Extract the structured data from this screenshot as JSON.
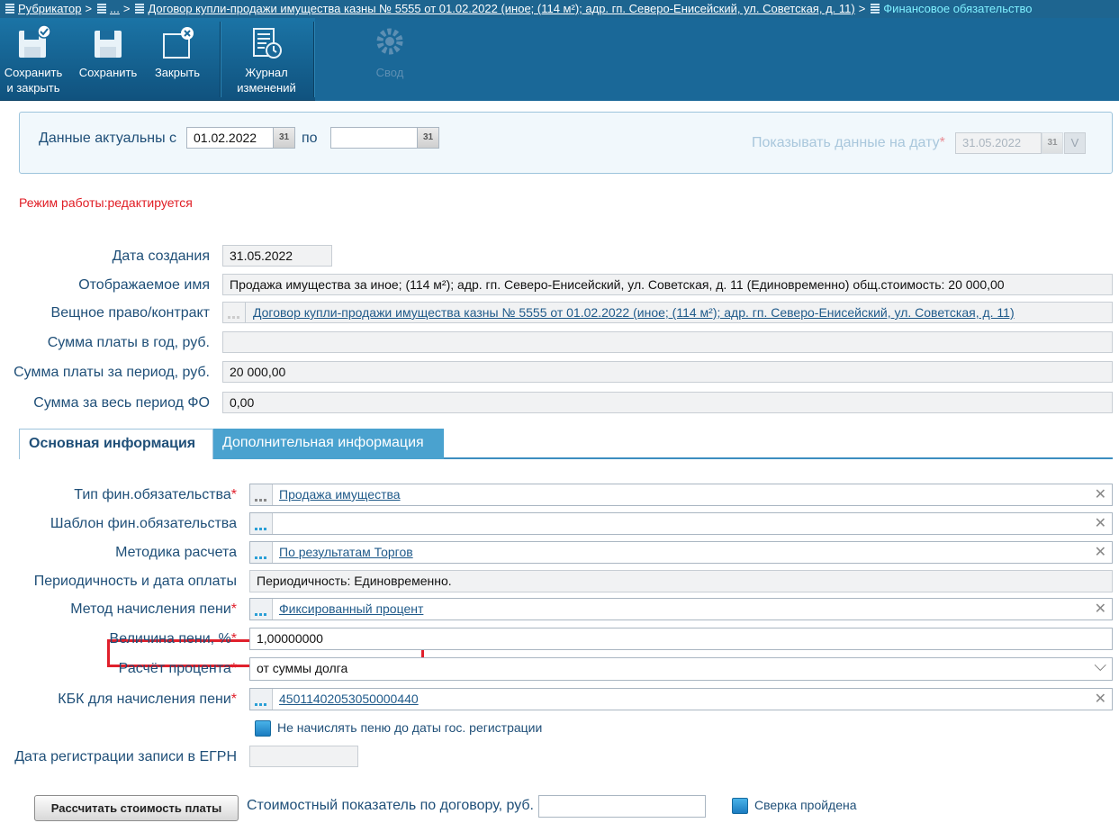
{
  "breadcrumb": {
    "root": "Рубрикатор",
    "ellipsis": "...",
    "contract": "Договор купли-продажи имущества казны № 5555 от 01.02.2022 (иное; (114 м²); адр. гп. Северо-Енисейский, ул. Советская, д. 11)",
    "current": "Финансовое обязательство"
  },
  "toolbar": {
    "save_close_1": "Сохранить",
    "save_close_2": "и закрыть",
    "save": "Сохранить",
    "close": "Закрыть",
    "journal_1": "Журнал",
    "journal_2": "изменений",
    "summary": "Свод"
  },
  "dates": {
    "actual_label": "Данные актуальны с",
    "from": "01.02.2022",
    "to_label": "по",
    "to": "",
    "show_label": "Показывать данные на дату",
    "show_date": "31.05.2022",
    "cal_text": "31"
  },
  "mode": "Режим работы:редактируется",
  "info": {
    "created_label": "Дата создания",
    "created": "31.05.2022",
    "display_name_label": "Отображаемое имя",
    "display_name": "Продажа имущества за иное; (114 м²); адр. гп. Северо-Енисейский, ул. Советская, д. 11 (Единовременно) общ.стоимость: 20 000,00",
    "right_label": "Вещное право/контракт",
    "right": "Договор купли-продажи имущества казны № 5555 от 01.02.2022 (иное; (114 м²); адр. гп. Северо-Енисейский, ул. Советская, д. 11)",
    "year_sum_label": "Сумма платы в год, руб.",
    "year_sum": "",
    "period_sum_label": "Сумма платы за период, руб.",
    "period_sum": "20 000,00",
    "total_label": "Сумма за весь период ФО",
    "total": "0,00"
  },
  "tabs": {
    "main": "Основная информация",
    "extra": "Дополнительная информация"
  },
  "form": {
    "type_label": "Тип фин.обязательства",
    "type": "Продажа имущества",
    "template_label": "Шаблон фин.обязательства",
    "template": "",
    "method_label": "Методика расчета",
    "method": "По результатам Торгов",
    "period_label": "Периодичность и дата оплаты",
    "period": "Периодичность: Единовременно.",
    "penalty_method_label": "Метод начисления пени",
    "penalty_method": "Фиксированный процент",
    "penalty_value_label": "Величина пени, %",
    "penalty_value": "1,00000000",
    "percent_calc_label": "Расчёт процента",
    "percent_calc": "от суммы долга",
    "kbk_label": "КБК для начисления пени",
    "kbk": "45011402053050000440",
    "no_penalty_label": "Не начислять пеню до даты гос. регистрации",
    "egrn_label": "Дата регистрации записи в ЕГРН",
    "egrn": "",
    "required_mark": "*",
    "clear_symbol": "✕",
    "dropdown_symbol": "⌵"
  },
  "bottom": {
    "calc_button": "Рассчитать стоимость платы",
    "cost_label": "Стоимостный показатель по договору, руб.",
    "cost": "",
    "check_label": "Сверка пройдена"
  },
  "colors": {
    "toolbar": "#1a6898",
    "required": "#e0202c",
    "highlight": "#e0202c",
    "link": "#1f5a8a"
  }
}
